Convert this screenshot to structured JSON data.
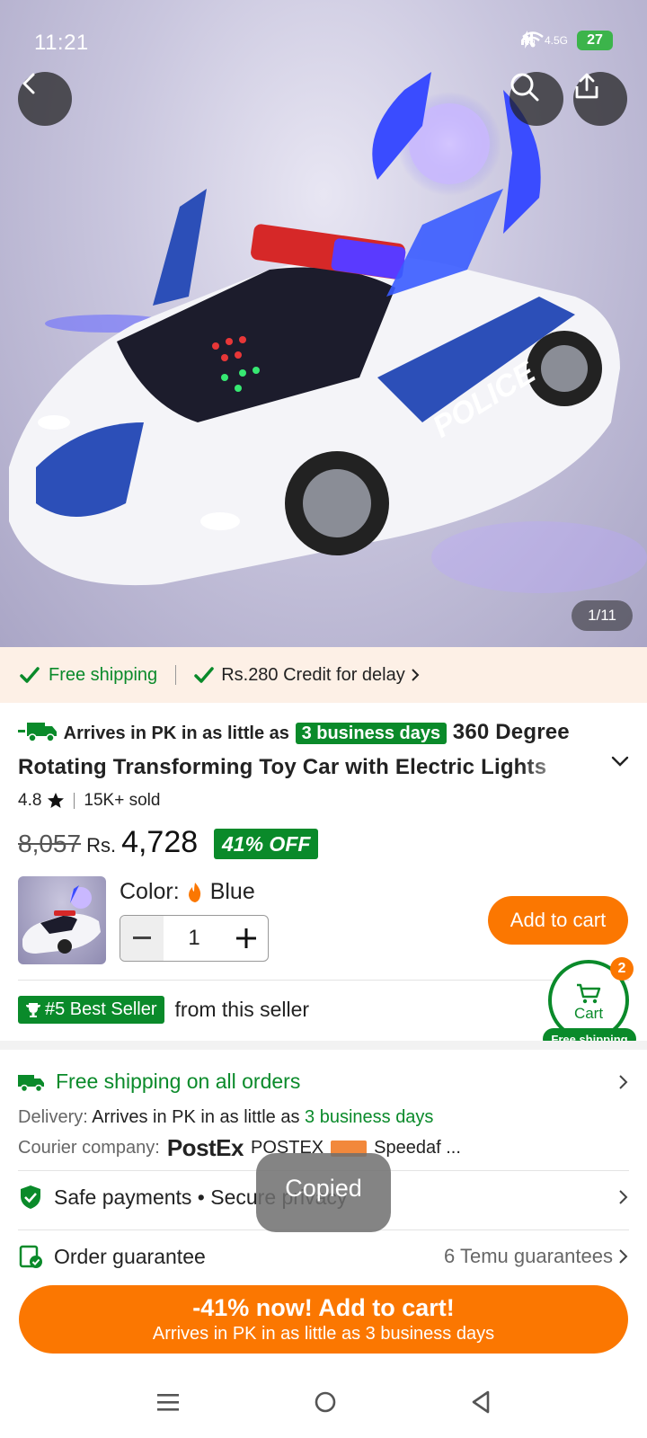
{
  "status_bar": {
    "time": "11:21",
    "network_1": "4G",
    "network_2": "4.5G",
    "battery": "27"
  },
  "gallery": {
    "counter": "1/11",
    "image_label": "POLICE"
  },
  "shipping_strip": {
    "free_shipping": "Free shipping",
    "credit": "Rs.280 Credit for delay"
  },
  "product": {
    "arrives_prefix": "Arrives in PK in as little as",
    "arrives_badge": "3 business days",
    "title": "360 Degree Rotating Transforming Toy Car with Electric Lights",
    "rating": "4.8",
    "sold": "15K+ sold",
    "old_price": "8,057",
    "currency": "Rs.",
    "price": "4,728",
    "discount": "41% OFF",
    "color_label": "Color:",
    "color_value": "Blue",
    "quantity": "1",
    "add_to_cart": "Add to cart"
  },
  "seller": {
    "best_seller_tag": "#5 Best Seller",
    "best_seller_suffix": "from this seller"
  },
  "floating_cart": {
    "count": "2",
    "label": "Cart",
    "shipping": "Free shipping"
  },
  "delivery": {
    "headline": "Free shipping on all orders",
    "delivery_label": "Delivery:",
    "delivery_text": "Arrives in PK in as little as",
    "delivery_days": "3 business days",
    "courier_label": "Courier company:",
    "courier_1": "PostEx",
    "courier_2": "POSTEX",
    "courier_3": "Speedaf ..."
  },
  "rows": {
    "safe_payments": "Safe payments • Secure privacy",
    "order_guarantee": "Order guarantee",
    "guarantees": "6 Temu guarantees"
  },
  "toast": "Copied",
  "cta": {
    "line1": "-41% now! Add to cart!",
    "line2": "Arrives in PK in as little as 3 business days"
  },
  "colors": {
    "accent_orange": "#fb7701",
    "accent_green": "#0a8a2a",
    "strip_bg": "#fdf0e6"
  }
}
